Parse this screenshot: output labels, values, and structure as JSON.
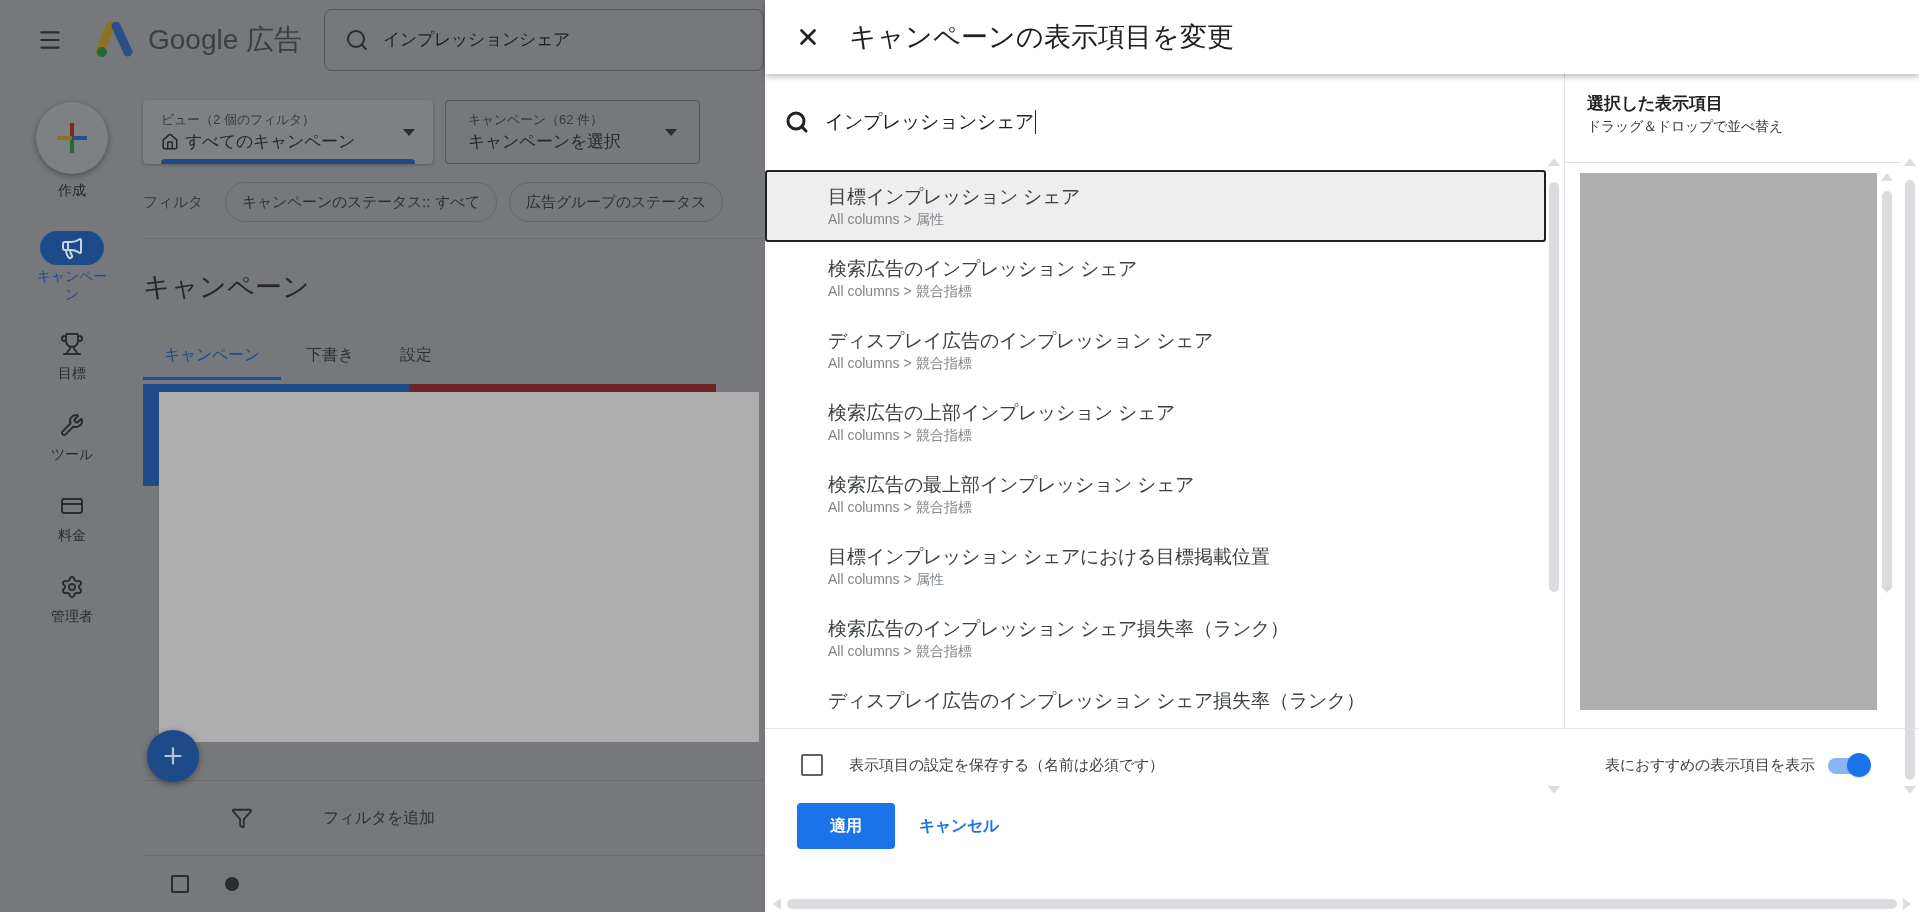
{
  "app": {
    "brand": "Google 広告",
    "search": {
      "value": "インプレッションシェア"
    },
    "create_label": "作成",
    "nav": [
      {
        "label": "キャンペーン",
        "selected": true
      },
      {
        "label": "目標",
        "selected": false
      },
      {
        "label": "ツール",
        "selected": false
      },
      {
        "label": "料金",
        "selected": false
      },
      {
        "label": "管理者",
        "selected": false
      }
    ],
    "view_selector": {
      "label": "ビュー（2 個のフィルタ）",
      "value": "すべてのキャンペーン"
    },
    "campaign_selector": {
      "label": "キャンペーン（62 件）",
      "value": "キャンペーンを選択"
    },
    "filter_label": "フィルタ",
    "filter_chips": [
      "キャンペーンのステータス:: すべて",
      "広告グループのステータス"
    ],
    "page_title": "キャンペーン",
    "tabs": [
      {
        "label": "キャンペーン",
        "selected": true
      },
      {
        "label": "下書き",
        "selected": false
      },
      {
        "label": "設定",
        "selected": false
      }
    ],
    "add_filter": "フィルタを追加",
    "campaign_row": {
      "checked": false
    }
  },
  "dialog": {
    "title": "キャンペーンの表示項目を変更",
    "search": {
      "value": "インプレッションシェア"
    },
    "columns": [
      {
        "name": "目標インプレッション シェア",
        "path": "All columns > 属性",
        "selected": true
      },
      {
        "name": "検索広告のインプレッション シェア",
        "path": "All columns > 競合指標",
        "selected": false
      },
      {
        "name": "ディスプレイ広告のインプレッション シェア",
        "path": "All columns > 競合指標",
        "selected": false
      },
      {
        "name": "検索広告の上部インプレッション シェア",
        "path": "All columns > 競合指標",
        "selected": false
      },
      {
        "name": "検索広告の最上部インプレッション シェア",
        "path": "All columns > 競合指標",
        "selected": false
      },
      {
        "name": "目標インプレッション シェアにおける目標掲載位置",
        "path": "All columns > 属性",
        "selected": false
      },
      {
        "name": "検索広告のインプレッション シェア損失率（ランク）",
        "path": "All columns > 競合指標",
        "selected": false
      },
      {
        "name": "ディスプレイ広告のインプレッション シェア損失率（ランク）",
        "selected": false
      }
    ],
    "selected_panel": {
      "title": "選択した表示項目",
      "subtitle": "ドラッグ＆ドロップで並べ替え"
    },
    "save_setting": {
      "label": "表示項目の設定を保存する（名前は必須です）",
      "checked": false
    },
    "recommended": {
      "label": "表におすすめの表示項目を表示",
      "on": true
    },
    "buttons": [
      {
        "label": "適用",
        "kind": "primary"
      },
      {
        "label": "キャンセル",
        "kind": "text"
      }
    ]
  }
}
